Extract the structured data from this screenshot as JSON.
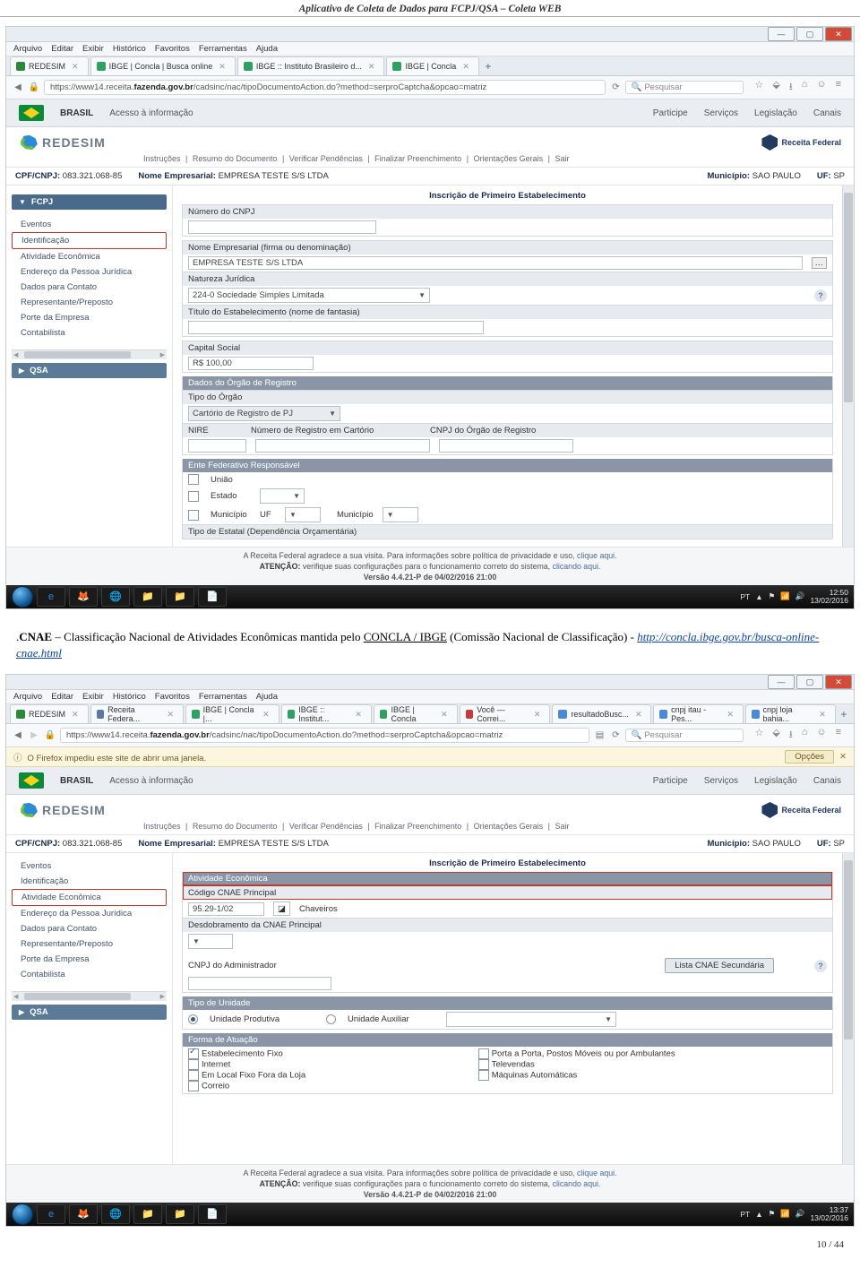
{
  "doc": {
    "header": "Aplicativo de Coleta de Dados para FCPJ/QSA – Coleta WEB",
    "page_num": "10 / 44",
    "para_prefix": ".",
    "para_bold": "CNAE",
    "para_rest1": " – Classificação Nacional de Atividades Econômicas mantida pelo ",
    "para_u": "CONCLA / IBGE",
    "para_rest2": " (Comissão Nacional de Classificação) - ",
    "para_link": "http://concla.ibge.gov.br/busca-online-cnae.html"
  },
  "ff_menu": [
    "Arquivo",
    "Editar",
    "Exibir",
    "Histórico",
    "Favoritos",
    "Ferramentas",
    "Ajuda"
  ],
  "search_placeholder": "Pesquisar",
  "taskbar_icons": [
    "e",
    "🦊",
    "🌐",
    "📁",
    "📁",
    "📄"
  ],
  "gov": {
    "brasil": "BRASIL",
    "acesso": "Acesso à informação",
    "links": [
      "Participe",
      "Serviços",
      "Legislação",
      "Canais"
    ],
    "redesim": "REDESIM",
    "rf": "Receita Federal",
    "instrucoes": [
      "Instruções",
      "Resumo do Documento",
      "Verificar Pendências",
      "Finalizar Preenchimento",
      "Orientações Gerais",
      "Sair"
    ]
  },
  "company": {
    "cpf_lbl": "CPF/CNPJ:",
    "cpf": "083.321.068-85",
    "nome_lbl": "Nome Empresarial:",
    "nome": "EMPRESA TESTE S/S LTDA",
    "mun_lbl": "Município:",
    "mun": "SAO PAULO",
    "uf_lbl": "UF:",
    "uf": "SP"
  },
  "form_title": "Inscrição de Primeiro Estabelecimento",
  "s1": {
    "tabs": [
      {
        "text": "REDESIM",
        "fav": "#2a8a3a"
      },
      {
        "text": "IBGE | Concla | Busca online",
        "fav": "#30a060"
      },
      {
        "text": "IBGE :: Instituto Brasileiro d...",
        "fav": "#30a060"
      },
      {
        "text": "IBGE | Concla",
        "fav": "#30a060"
      }
    ],
    "url_pre": "https://www14.receita.",
    "url_bold": "fazenda.gov.br",
    "url_post": "/cadsinc/nac/tipoDocumentoAction.do?method=serproCaptcha&opcao=matriz",
    "side": {
      "fcpj": "FCPJ",
      "items": [
        "Eventos",
        "Identificação",
        "Atividade Econômica",
        "Endereço da Pessoa Jurídica",
        "Dados para Contato",
        "Representante/Preposto",
        "Porte da Empresa",
        "Contabilista"
      ],
      "hi_index": 1,
      "qsa": "QSA"
    },
    "form": {
      "num_cnpj": "Número do CNPJ",
      "nome_emp": "Nome Empresarial (firma ou denominação)",
      "nome_val": "EMPRESA TESTE S/S LTDA",
      "nat": "Natureza Jurídica",
      "nat_val": "224-0   Sociedade Simples Limitada",
      "titulo": "Título do Estabelecimento (nome de fantasia)",
      "capital": "Capital Social",
      "capital_val": "R$ 100,00",
      "dados_orgao": "Dados do Órgão de Registro",
      "tipo_orgao": "Tipo do Órgão",
      "tipo_orgao_val": "Cartório de Registro de PJ",
      "nire": "NIRE",
      "numreg": "Número de Registro em Cartório",
      "cnpj_orgao": "CNPJ do Órgão de Registro",
      "ente": "Ente Federativo Responsável",
      "uniao": "União",
      "estado": "Estado",
      "municipio": "Município",
      "uf": "UF",
      "tipo_estatal": "Tipo de Estatal (Dependência Orçamentária)"
    },
    "footer": {
      "l1a": "A Receita Federal agradece a sua visita. Para informações sobre política de privacidade e uso, ",
      "l1b": "clique aqui.",
      "warn": "ATENÇÃO:",
      "l2a": " verifique suas configurações para o funcionamento correto do sistema, ",
      "l2b": "clicando aqui.",
      "l3": "Versão 4.4.21-P de 04/02/2016 21:00"
    },
    "clock": {
      "time": "12:50",
      "date": "13/02/2016",
      "lang": "PT"
    }
  },
  "s2": {
    "tabs": [
      {
        "text": "REDESIM",
        "fav": "#2a8a3a"
      },
      {
        "text": "Receita Federa...",
        "fav": "#5a7aa0"
      },
      {
        "text": "IBGE | Concla |...",
        "fav": "#30a060"
      },
      {
        "text": "IBGE :: Institut...",
        "fav": "#30a060"
      },
      {
        "text": "IBGE | Concla",
        "fav": "#30a060"
      },
      {
        "text": "Você — Correi...",
        "fav": "#c73a3a"
      },
      {
        "text": "resultadoBusc...",
        "fav": "#4a8ad4"
      },
      {
        "text": "cnpj itau - Pes...",
        "fav": "#4a8ad4"
      },
      {
        "text": "cnpj loja bahia...",
        "fav": "#4a8ad4"
      }
    ],
    "url_pre": "https://www14.receita.",
    "url_bold": "fazenda.gov.br",
    "url_post": "/cadsinc/nac/tipoDocumentoAction.do?method=serproCaptcha&opcao=matriz",
    "info": {
      "msg": "O Firefox impediu este site de abrir uma janela.",
      "opt": "Opções"
    },
    "side": {
      "items": [
        "Eventos",
        "Identificação",
        "Atividade Econômica",
        "Endereço da Pessoa Jurídica",
        "Dados para Contato",
        "Representante/Preposto",
        "Porte da Empresa",
        "Contabilista"
      ],
      "hi_index": 2,
      "qsa": "QSA"
    },
    "form": {
      "ativ": "Atividade Econômica",
      "codigo": "Código CNAE Principal",
      "codigo_val": "95.29-1/02",
      "chaveiros": "Chaveiros",
      "desdobra": "Desdobramento da CNAE Principal",
      "cnpj_adm": "CNPJ do Administrador",
      "lista_btn": "Lista CNAE Secundária",
      "tipo_uni": "Tipo de Unidade",
      "uni_prod": "Unidade Produtiva",
      "uni_aux": "Unidade Auxiliar",
      "forma": "Forma de Atuação",
      "fa": [
        "Estabelecimento Fixo",
        "Internet",
        "Em Local Fixo Fora da Loja",
        "Correio",
        "Porta a Porta, Postos Móveis ou por Ambulantes",
        "Televendas",
        "Máquinas Automáticas"
      ]
    },
    "clock": {
      "time": "13:37",
      "date": "13/02/2016",
      "lang": "PT"
    }
  }
}
